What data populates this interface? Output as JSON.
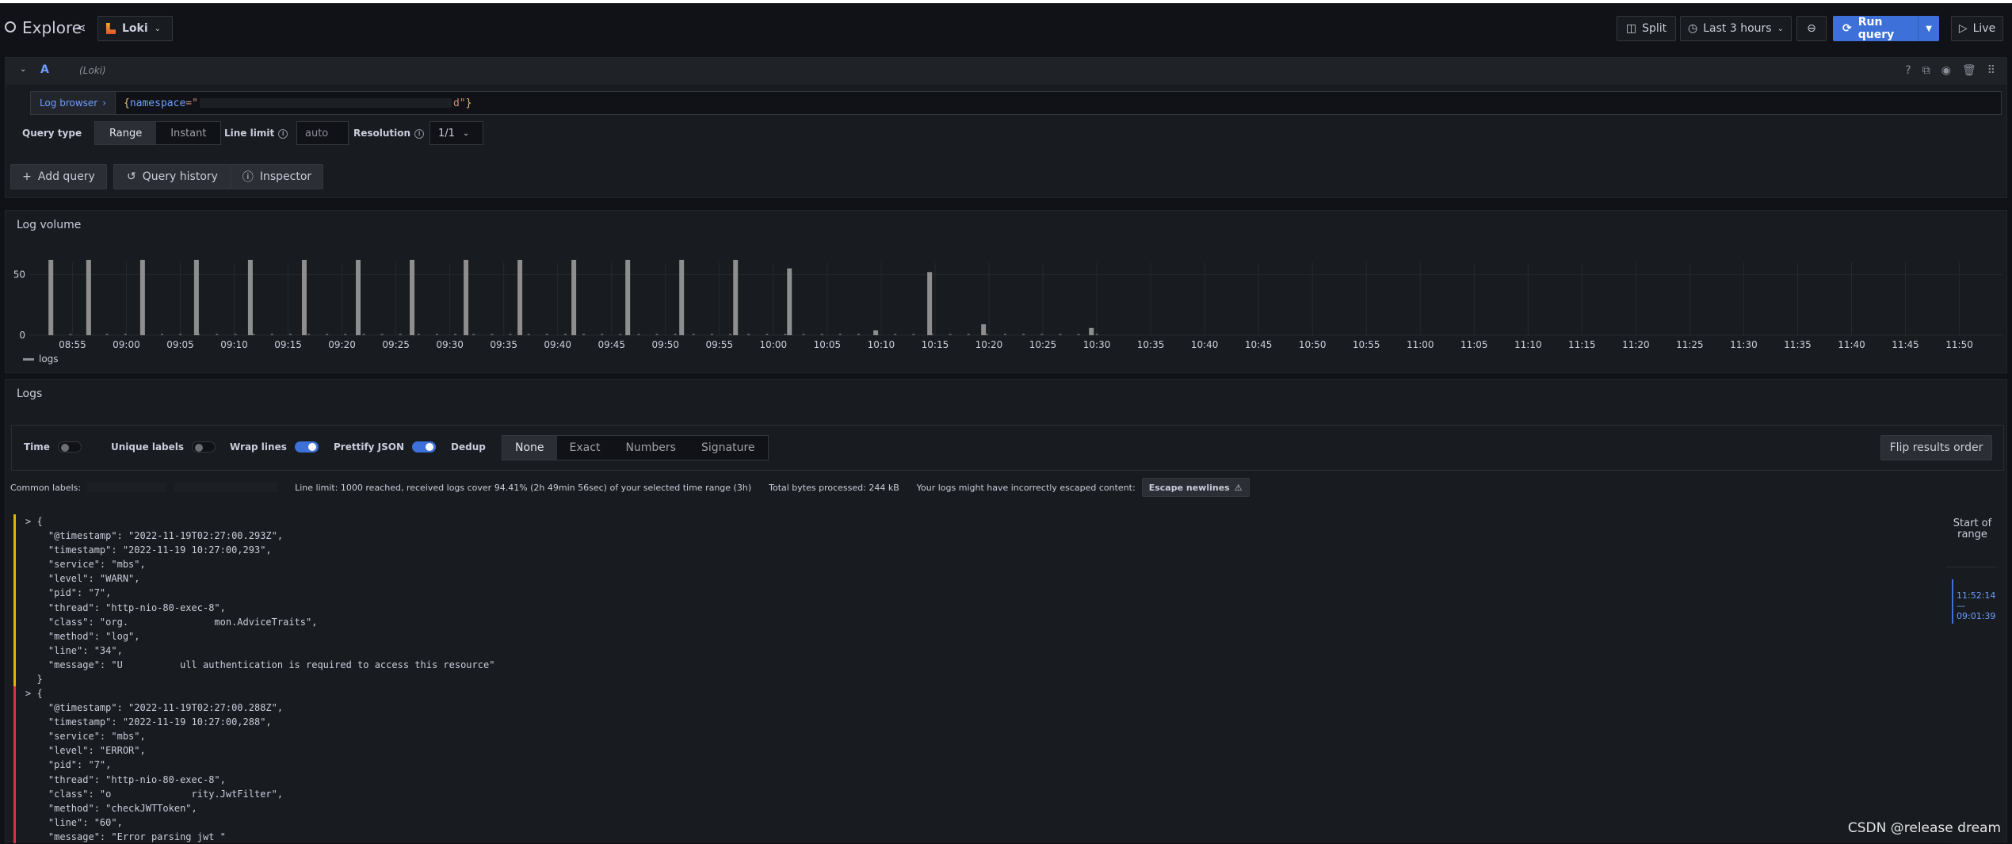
{
  "header": {
    "title": "Explore",
    "datasource": "Loki",
    "split_label": "Split",
    "time_range": "Last 3 hours",
    "run_query_label": "Run query",
    "live_label": "Live"
  },
  "query": {
    "letter": "A",
    "datasource_hint": "(Loki)",
    "log_browser_label": "Log browser",
    "expr_open": "{",
    "expr_key": "namespace",
    "expr_eq": "=\"",
    "expr_tail": "d\"",
    "expr_close": "}",
    "query_type_label": "Query type",
    "query_types": [
      "Range",
      "Instant"
    ],
    "active_query_type": "Range",
    "line_limit_label": "Line limit",
    "line_limit_placeholder": "auto",
    "resolution_label": "Resolution",
    "resolution_value": "1/1",
    "add_query_label": "Add query",
    "query_history_label": "Query history",
    "inspector_label": "Inspector"
  },
  "volume": {
    "title": "Log volume",
    "legend": "logs"
  },
  "chart_data": {
    "type": "bar",
    "title": "Log volume",
    "xlabel": "",
    "ylabel": "",
    "ylim": [
      0,
      60
    ],
    "yticks": [
      0,
      50
    ],
    "xtick_labels": [
      "08:55",
      "09:00",
      "09:05",
      "09:10",
      "09:15",
      "09:20",
      "09:25",
      "09:30",
      "09:35",
      "09:40",
      "09:45",
      "09:50",
      "09:55",
      "10:00",
      "10:05",
      "10:10",
      "10:15",
      "10:20",
      "10:25",
      "10:30",
      "10:35",
      "10:40",
      "10:45",
      "10:50",
      "10:55",
      "11:00",
      "11:05",
      "11:10",
      "11:15",
      "11:20",
      "11:25",
      "11:30",
      "11:35",
      "11:40",
      "11:45",
      "11:50"
    ],
    "grid": true,
    "legend_placement": "bottom-left",
    "series": [
      {
        "name": "logs",
        "x": [
          "08:53",
          "08:56:30",
          "09:01:30",
          "09:06:30",
          "09:11:30",
          "09:16:30",
          "09:21:30",
          "09:26:30",
          "09:31:30",
          "09:36:30",
          "09:41:30",
          "09:46:30",
          "09:51:30",
          "09:56:30",
          "10:01:30",
          "10:09:30",
          "10:14:30",
          "10:19:30",
          "10:29:30"
        ],
        "values": [
          62,
          62,
          62,
          62,
          62,
          62,
          62,
          62,
          62,
          62,
          62,
          62,
          62,
          62,
          55,
          4,
          52,
          9,
          6
        ]
      }
    ]
  },
  "logs": {
    "title": "Logs",
    "options": {
      "time_label": "Time",
      "unique_labels_label": "Unique labels",
      "wrap_lines_label": "Wrap lines",
      "prettify_json_label": "Prettify JSON",
      "dedup_label": "Dedup",
      "dedup_options": [
        "None",
        "Exact",
        "Numbers",
        "Signature"
      ],
      "active_dedup": "None",
      "flip_label": "Flip results order"
    },
    "common_labels_label": "Common labels:",
    "line_limit_text": "Line limit: 1000 reached, received logs cover 94.41% (2h 49min 56sec) of your selected time range (3h)",
    "bytes_text": "Total bytes processed: 244 kB",
    "escape_warning": "Your logs might have incorrectly escaped content:",
    "escape_button": "Escape newlines",
    "rows": [
      {
        "level": "warn",
        "text": "> {\n    \"@timestamp\": \"2022-11-19T02:27:00.293Z\",\n    \"timestamp\": \"2022-11-19 10:27:00,293\",\n    \"service\": \"mbs\",\n    \"level\": \"WARN\",\n    \"pid\": \"7\",\n    \"thread\": \"http-nio-80-exec-8\",\n    \"class\": \"org.               mon.AdviceTraits\",\n    \"method\": \"log\",\n    \"line\": \"34\",\n    \"message\": \"U          ull authentication is required to access this resource\"\n  }"
      },
      {
        "level": "error",
        "text": "> {\n    \"@timestamp\": \"2022-11-19T02:27:00.288Z\",\n    \"timestamp\": \"2022-11-19 10:27:00,288\",\n    \"service\": \"mbs\",\n    \"level\": \"ERROR\",\n    \"pid\": \"7\",\n    \"thread\": \"http-nio-80-exec-8\",\n    \"class\": \"o              rity.JwtFilter\",\n    \"method\": \"checkJWTToken\",\n    \"line\": \"60\",\n    \"message\": \"Error parsing jwt \""
      }
    ],
    "range_label": "Start of range",
    "range_start": "11:52:14",
    "range_sep": "—",
    "range_end": "09:01:39"
  },
  "watermark": "CSDN @release dream"
}
